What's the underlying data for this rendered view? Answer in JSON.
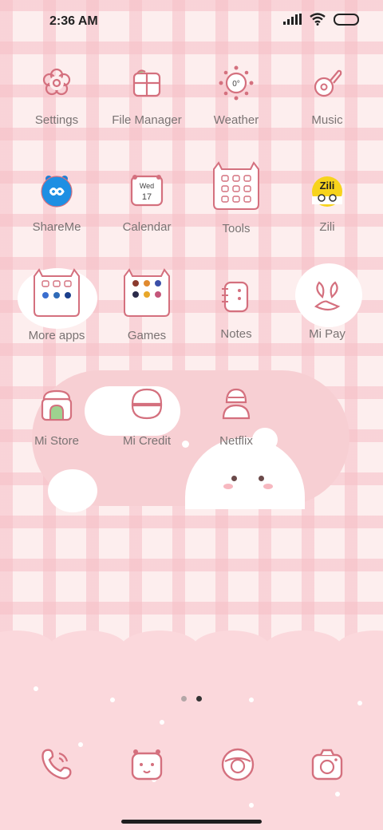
{
  "status_bar": {
    "time": "2:36 AM",
    "icons": [
      "signal-icon",
      "wifi-icon",
      "battery-icon"
    ]
  },
  "apps": [
    {
      "label": "Settings",
      "icon": "settings-icon"
    },
    {
      "label": "File Manager",
      "icon": "file-manager-icon"
    },
    {
      "label": "Weather",
      "icon": "weather-icon",
      "icon_text": "0°"
    },
    {
      "label": "Music",
      "icon": "music-icon"
    },
    {
      "label": "ShareMe",
      "icon": "shareme-icon"
    },
    {
      "label": "Calendar",
      "icon": "calendar-icon",
      "icon_day": "Wed",
      "icon_date": "17"
    },
    {
      "label": "Tools",
      "icon": "tools-folder-icon"
    },
    {
      "label": "Zili",
      "icon": "zili-icon",
      "icon_text": "Zili"
    },
    {
      "label": "More apps",
      "icon": "more-apps-folder-icon"
    },
    {
      "label": "Games",
      "icon": "games-folder-icon"
    },
    {
      "label": "Notes",
      "icon": "notes-icon"
    },
    {
      "label": "Mi Pay",
      "icon": "mi-pay-icon"
    },
    {
      "label": "Mi Store",
      "icon": "mi-store-icon"
    },
    {
      "label": "Mi Credit",
      "icon": "mi-credit-icon"
    },
    {
      "label": "Netflix",
      "icon": "netflix-icon"
    }
  ],
  "page_indicator": {
    "count": 2,
    "active": 2
  },
  "dock": [
    {
      "name": "phone",
      "icon": "phone-icon"
    },
    {
      "name": "messages",
      "icon": "messages-icon"
    },
    {
      "name": "browser",
      "icon": "browser-icon"
    },
    {
      "name": "camera",
      "icon": "camera-icon"
    }
  ],
  "colors": {
    "line": "#d4707e",
    "background": "#fdeeee",
    "grid": "#f6bec6",
    "label": "#7a7373"
  }
}
